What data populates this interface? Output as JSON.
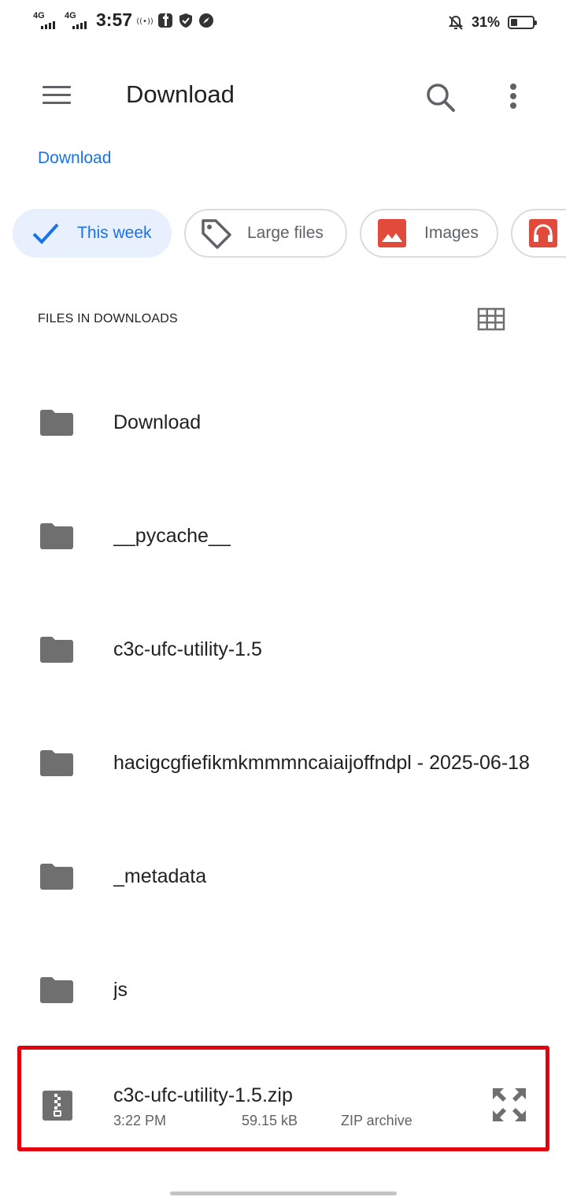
{
  "status_bar": {
    "network_1": "4G",
    "network_2": "4G",
    "time": "3:57",
    "battery_percent": "31%",
    "battery_level": 0.31,
    "icons": [
      "signal-icon",
      "hotspot-icon",
      "facebook-icon",
      "shield-icon",
      "compass-icon",
      "bell-off-icon",
      "battery-icon"
    ]
  },
  "app_bar": {
    "title": "Download",
    "icons": {
      "menu": "menu-icon",
      "search": "search-icon",
      "more": "more-vertical-icon"
    }
  },
  "breadcrumb": {
    "label": "Download"
  },
  "chips": [
    {
      "label": "This week",
      "icon": "check-icon",
      "active": true
    },
    {
      "label": "Large files",
      "icon": "tag-icon",
      "active": false
    },
    {
      "label": "Images",
      "icon": "image-icon",
      "active": false
    },
    {
      "label": "",
      "icon": "headphones-icon",
      "active": false
    }
  ],
  "section": {
    "title": "FILES IN DOWNLOADS",
    "view_toggle_icon": "grid-view-icon"
  },
  "folders": [
    {
      "name": "Download"
    },
    {
      "name": "__pycache__"
    },
    {
      "name": "c3c-ufc-utility-1.5"
    },
    {
      "name": "hacigcgfiefikmkmmmncaiaijoffndpl - 2025-06-18"
    },
    {
      "name": "_metadata"
    },
    {
      "name": "js"
    }
  ],
  "file": {
    "name": "c3c-ufc-utility-1.5.zip",
    "time": "3:22 PM",
    "size": "59.15 kB",
    "type": "ZIP archive",
    "icon": "zip-file-icon",
    "action_icon": "expand-icon"
  },
  "colors": {
    "accent": "#1a73e8",
    "active_chip_bg": "#e8f0fe",
    "icon_gray": "#6f6f6f",
    "highlight_red": "#e3000f",
    "chip_red": "#e14b3b"
  }
}
